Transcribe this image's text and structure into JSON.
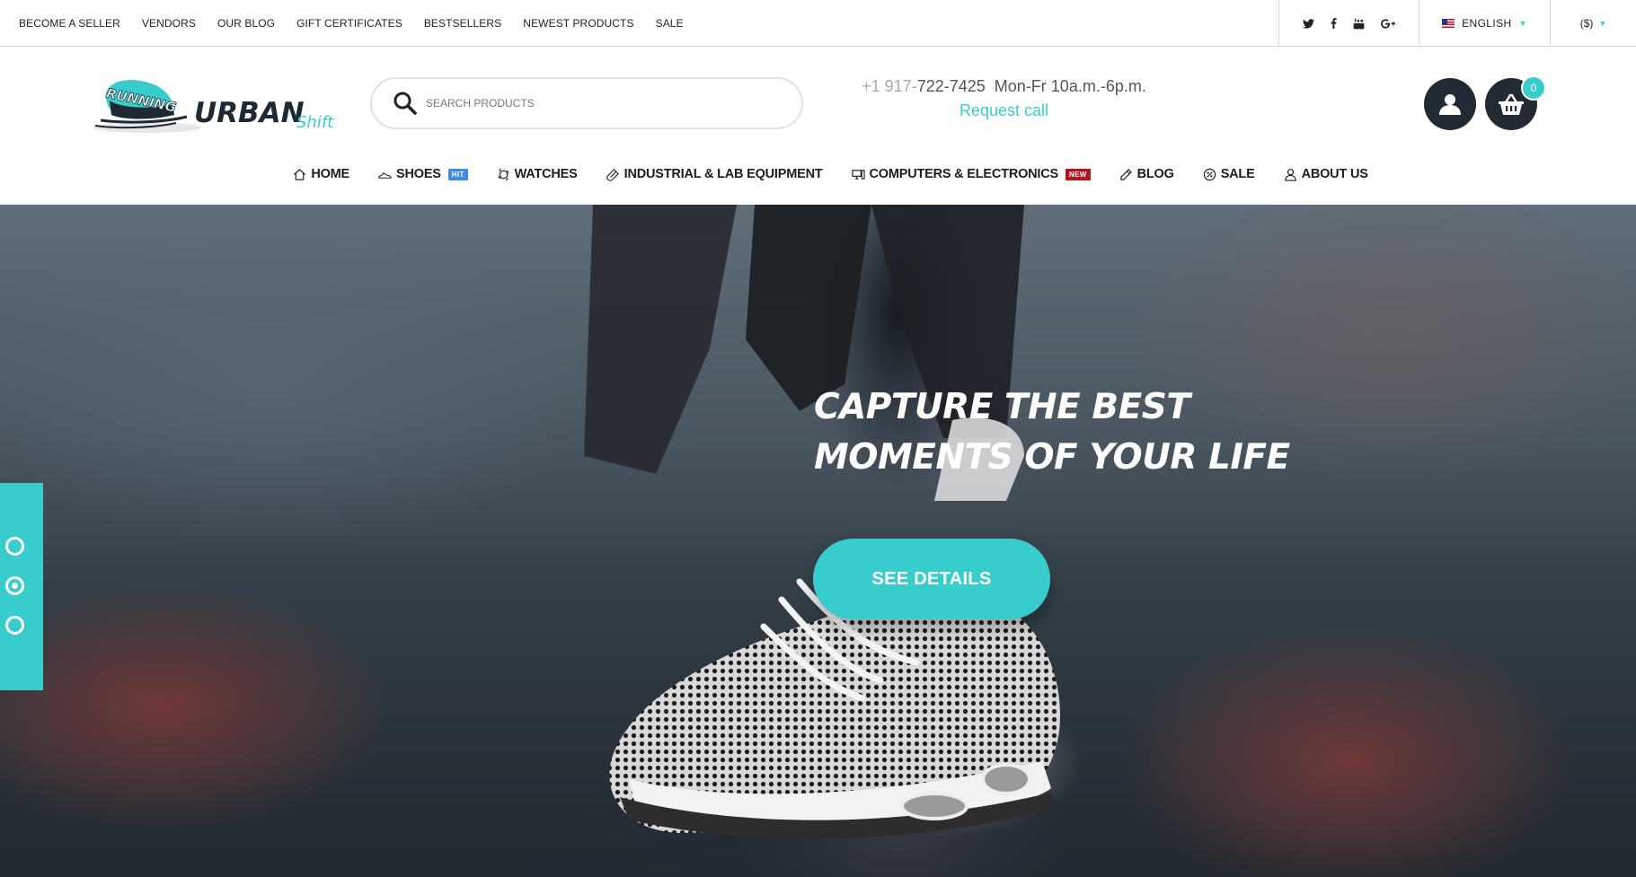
{
  "top_links": [
    "BECOME A SELLER",
    "VENDORS",
    "OUR BLOG",
    "GIFT CERTIFICATES",
    "BESTSELLERS",
    "NEWEST PRODUCTS",
    "SALE"
  ],
  "social_icons": [
    "twitter-icon",
    "facebook-icon",
    "youtube-icon",
    "google-plus-icon"
  ],
  "language": "ENGLISH",
  "currency": "($)",
  "logo": {
    "mark": "RUNNING",
    "brand": "URBAN",
    "sub": "Shift"
  },
  "search": {
    "placeholder": "SEARCH PRODUCTS"
  },
  "contact": {
    "phone_prefix": "+1 917-",
    "phone_number": "722-7425",
    "hours": "Mon-Fr 10a.m.-6p.m.",
    "request_call": "Request call"
  },
  "cart": {
    "count": "0"
  },
  "nav": [
    {
      "label": "HOME",
      "icon": "home-icon"
    },
    {
      "label": "SHOES",
      "icon": "shoe-icon",
      "badge": "HIT"
    },
    {
      "label": "WATCHES",
      "icon": "watch-icon"
    },
    {
      "label": "INDUSTRIAL & LAB EQUIPMENT",
      "icon": "lab-icon"
    },
    {
      "label": "COMPUTERS & ELECTRONICS",
      "icon": "computer-icon",
      "badge": "NEW"
    },
    {
      "label": "BLOG",
      "icon": "pencil-icon"
    },
    {
      "label": "SALE",
      "icon": "sale-icon"
    },
    {
      "label": "ABOUT US",
      "icon": "user-outline-icon"
    }
  ],
  "hero": {
    "title_line1": "CAPTURE THE BEST",
    "title_line2": "MOMENTS OF YOUR LIFE",
    "button_label": "SEE DETAILS",
    "slide_count": 3,
    "active_slide": 2
  },
  "colors": {
    "accent": "#39cccd",
    "dark": "#212a33",
    "hit_badge": "#3f8ee0",
    "new_badge": "#b5121b"
  }
}
